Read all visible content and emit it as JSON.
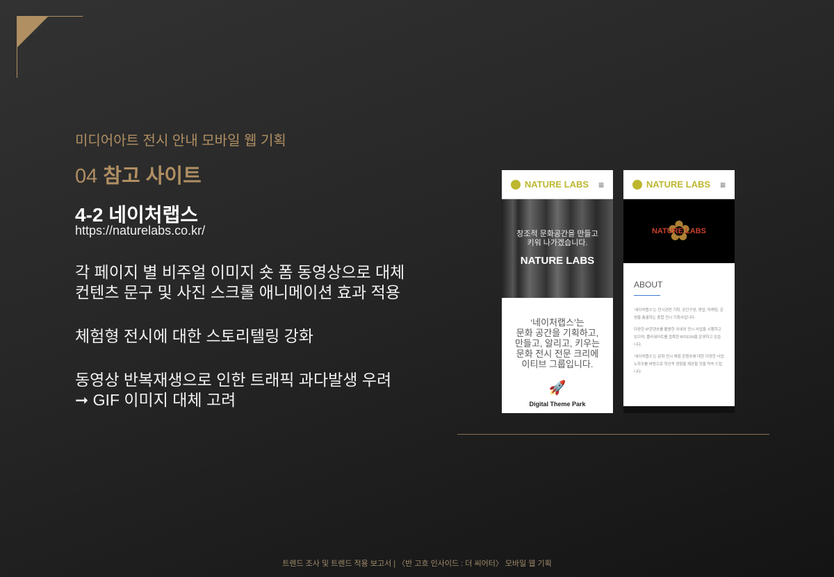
{
  "colors": {
    "gold": "#b08f63",
    "accent_blue": "#3a7bd5",
    "logo": "#bdb72f"
  },
  "subtitle": "미디어아트 전시 안내 모바일 웹 기획",
  "section": {
    "number": "04",
    "title": "참고 사이트"
  },
  "heading": "4-2 네이처랩스",
  "url": "https://naturelabs.co.kr/",
  "bullets": [
    [
      "각 페이지 별 비주얼 이미지 숏 폼 동영상으로 대체",
      "컨텐츠 문구 및 사진 스크롤 애니메이션 효과 적용"
    ],
    [
      "체험형 전시에 대한 스토리텔링 강화"
    ],
    [
      "동영상 반복재생으로 인한 트래픽 과다발생 우려",
      "➞ GIF 이미지 대체 고려"
    ]
  ],
  "phone1": {
    "logo": "NATURE LABS",
    "menu_icon": "hamburger-icon",
    "hero_line1": "창조적 문화공간을 만들고",
    "hero_line2": "키워 나가겠습니다.",
    "hero_title": "NATURE LABS",
    "intro": [
      "‘네이처랩스’는",
      "문화 공간을 기획하고,",
      "만들고, 알리고, 키우는",
      "문화 전시 전문 크리에",
      "이티브 그룹입니다."
    ],
    "rocket_icon": "rocket-icon",
    "caption": "Digital Theme Park"
  },
  "phone2": {
    "logo": "NATURE LABS",
    "hero_title": "NATURE LABS",
    "about_title": "ABOUT",
    "paragraphs": [
      "‘네이처랩스’는 전시관련 기획, 공간구성, 영업, 마케팅, 운영을 총괄하는 종합 전시 기획사입니다.",
      "다양한 IP콘텐츠를 활용한 국내외 전시 사업을 시행하고 있으며, 플라워아트를 접목한 BITESN을 운영하고 있습니다.",
      "‘네이처랩스’는 문화 전시 체험 콘텐츠에 대한 다양한 사업 노하우를 바탕으로 혁신적 경험을 제공할 것을 약속 드립니다."
    ]
  },
  "footer": "트렌드 조사 및 트렌드 적용 보고서 | 〈반 고흐 인사이드 : 더 씨어터〉 모바일 웹 기획"
}
